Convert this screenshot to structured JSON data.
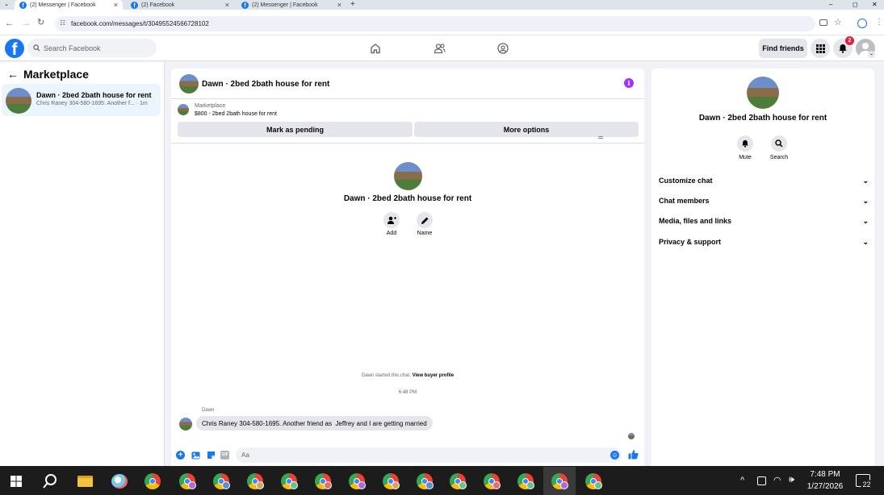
{
  "browser": {
    "tabs": [
      {
        "label": "(2) Messenger | Facebook",
        "active": true
      },
      {
        "label": "(2) Facebook",
        "active": false
      },
      {
        "label": "(2) Messenger | Facebook",
        "active": false
      }
    ],
    "new_tab": "+",
    "url": "facebook.com/messages/t/30495524566728102",
    "window_controls": [
      "–",
      "◻",
      "✕"
    ]
  },
  "fb": {
    "search_placeholder": "Search Facebook",
    "find_friends": "Find friends",
    "notification_count": "2"
  },
  "left": {
    "back_label": "Marketplace",
    "chat": {
      "title": "Dawn · 2bed 2bath house for rent",
      "preview": "Chris Raney 304-580-1695. Another f...",
      "time": "· 1m"
    }
  },
  "center": {
    "header_title": "Dawn · 2bed 2bath house for rent",
    "listing_source": "Marketplace",
    "listing_title": "$800 - 2bed 2bath house for rent",
    "mark_pending": "Mark as pending",
    "more_options": "More options",
    "profile_name": "Dawn · 2bed 2bath house for rent",
    "add_label": "Add",
    "name_label": "Name",
    "started_text": "Dawn started this chat.",
    "view_buyer": "View buyer profile",
    "timestamp": "6:48 PM",
    "sender": "Dawn",
    "message": "Chris Raney 304-580-1695. Another friend as  Jeffrey and I are getting married",
    "composer_placeholder": "Aa"
  },
  "right": {
    "name": "Dawn · 2bed 2bath house for rent",
    "mute": "Mute",
    "search": "Search",
    "sections": [
      "Customize chat",
      "Chat members",
      "Media, files and links",
      "Privacy & support"
    ]
  },
  "taskbar": {
    "time": "7:48 PM",
    "date": "1/27/2026",
    "notif": "22"
  },
  "colors": {
    "fb_blue": "#1877f2",
    "purple_info": "#a033ff",
    "taskbar": "#1c1c1c",
    "badge": "#e41e3f"
  }
}
